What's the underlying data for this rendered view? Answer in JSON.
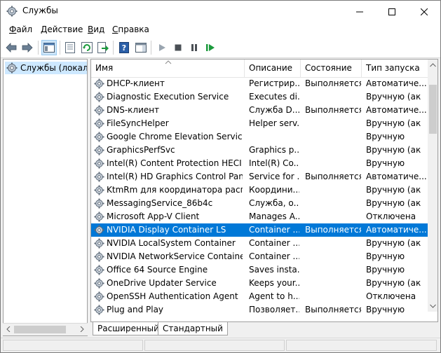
{
  "window": {
    "title": "Службы",
    "icon": "gear-icon"
  },
  "menu": [
    {
      "key": "file",
      "label": "Файл",
      "underline": "Ф",
      "rest": "айл"
    },
    {
      "key": "action",
      "label": "Действие",
      "underline": "Д",
      "rest": "ействие"
    },
    {
      "key": "view",
      "label": "Вид",
      "underline": "В",
      "rest": "ид"
    },
    {
      "key": "help",
      "label": "Справка",
      "underline": "С",
      "rest": "правка"
    }
  ],
  "toolbar": [
    "back-arrow-icon",
    "forward-arrow-icon",
    "console-tree-icon",
    "properties-icon",
    "refresh-icon",
    "export-icon",
    "help-icon",
    "panel-icon",
    "play-icon",
    "stop-icon",
    "pause-icon",
    "resume-icon"
  ],
  "tree": {
    "label": "Службы (локалы"
  },
  "columns": [
    "Имя",
    "Описание",
    "Состояние",
    "Тип запуска"
  ],
  "services": [
    {
      "name": "DHCP-клиент",
      "desc": "Регистрир...",
      "state": "Выполняется",
      "start": "Автоматиче..."
    },
    {
      "name": "Diagnostic Execution Service",
      "desc": "Executes di...",
      "state": "",
      "start": "Вручную (ак"
    },
    {
      "name": "DNS-клиент",
      "desc": "Служба D...",
      "state": "Выполняется",
      "start": "Автоматиче..."
    },
    {
      "name": "FileSyncHelper",
      "desc": "Helper serv...",
      "state": "",
      "start": "Вручную (ак"
    },
    {
      "name": "Google Chrome Elevation Service",
      "desc": "",
      "state": "",
      "start": "Вручную"
    },
    {
      "name": "GraphicsPerfSvc",
      "desc": "Graphics p...",
      "state": "",
      "start": "Вручную (ак"
    },
    {
      "name": "Intel(R) Content Protection HECI Se...",
      "desc": "Intel(R) Co...",
      "state": "",
      "start": "Вручную"
    },
    {
      "name": "Intel(R) HD Graphics Control Panel ...",
      "desc": "Service for ...",
      "state": "Выполняется",
      "start": "Автоматиче..."
    },
    {
      "name": "KtmRm для координатора распре...",
      "desc": "Координи...",
      "state": "",
      "start": "Вручную (ак"
    },
    {
      "name": "MessagingService_86b4c",
      "desc": "Служба, о...",
      "state": "",
      "start": "Вручную (ак"
    },
    {
      "name": "Microsoft App-V Client",
      "desc": "Manages A...",
      "state": "",
      "start": "Отключена"
    },
    {
      "name": "NVIDIA Display Container LS",
      "desc": "Container ...",
      "state": "Выполняется",
      "start": "Автоматиче..."
    },
    {
      "name": "NVIDIA LocalSystem Container",
      "desc": "Container ...",
      "state": "",
      "start": "Вручную (ак"
    },
    {
      "name": "NVIDIA NetworkService Container",
      "desc": "Container ...",
      "state": "",
      "start": "Вручную"
    },
    {
      "name": "Office 64 Source Engine",
      "desc": "Saves insta...",
      "state": "",
      "start": "Вручную"
    },
    {
      "name": "OneDrive Updater Service",
      "desc": "Keeps your...",
      "state": "",
      "start": "Вручную (ак"
    },
    {
      "name": "OpenSSH Authentication Agent",
      "desc": "Agent to h...",
      "state": "",
      "start": "Отключена"
    },
    {
      "name": "Plug and Play",
      "desc": "Позволяет...",
      "state": "Выполняется",
      "start": "Вручную"
    }
  ],
  "selected_row": 11,
  "tabs": [
    "Расширенный",
    "Стандартный"
  ],
  "colors": {
    "selection": "#0078d7",
    "accent_green": "#1b9a3c"
  }
}
